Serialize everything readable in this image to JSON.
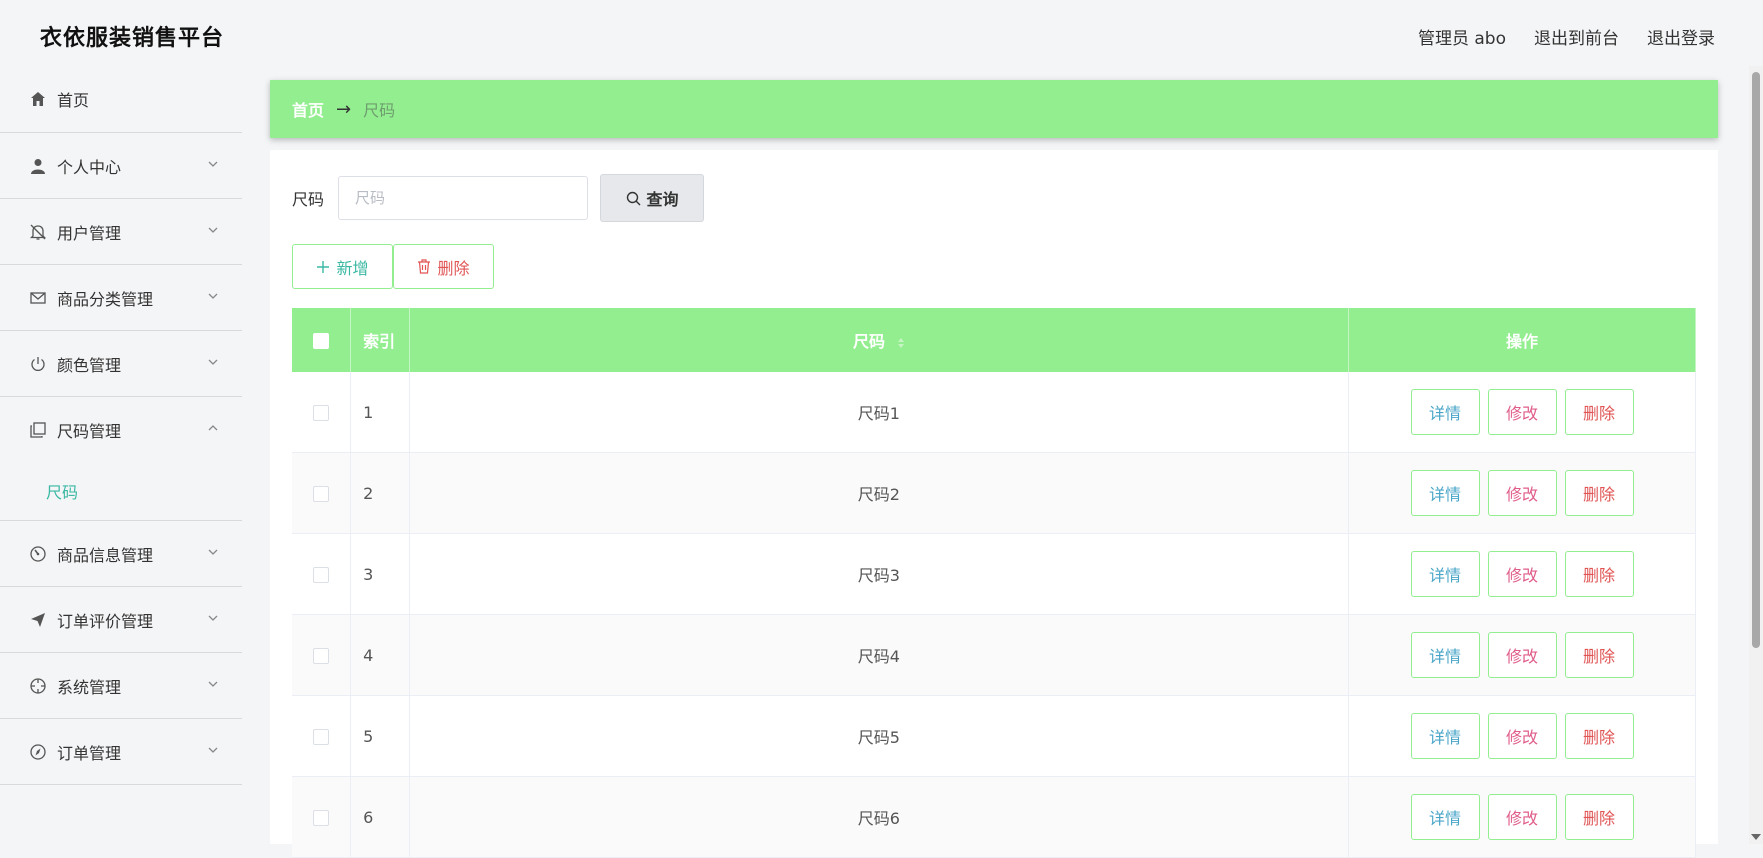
{
  "header": {
    "title": "衣依服装销售平台",
    "user": "管理员 abo",
    "to_front": "退出到前台",
    "logout": "退出登录"
  },
  "sidebar": {
    "items": [
      {
        "label": "首页",
        "icon": "home-icon"
      },
      {
        "label": "个人中心",
        "icon": "user-icon"
      },
      {
        "label": "用户管理",
        "icon": "bell-off-icon"
      },
      {
        "label": "商品分类管理",
        "icon": "mail-icon"
      },
      {
        "label": "颜色管理",
        "icon": "power-icon"
      },
      {
        "label": "尺码管理",
        "icon": "copy-icon"
      },
      {
        "label": "商品信息管理",
        "icon": "gauge-icon"
      },
      {
        "label": "订单评价管理",
        "icon": "send-icon"
      },
      {
        "label": "系统管理",
        "icon": "crosshair-icon"
      },
      {
        "label": "订单管理",
        "icon": "compass-icon"
      }
    ],
    "submenu": {
      "label": "尺码"
    }
  },
  "breadcrumb": {
    "home": "首页",
    "arrow": "→",
    "current": "尺码"
  },
  "search": {
    "label": "尺码",
    "placeholder": "尺码",
    "button": "查询"
  },
  "actions": {
    "add": "新增",
    "delete": "删除"
  },
  "table": {
    "headers": {
      "index": "索引",
      "size": "尺码",
      "ops": "操作"
    },
    "rows": [
      {
        "index": "1",
        "size": "尺码1"
      },
      {
        "index": "2",
        "size": "尺码2"
      },
      {
        "index": "3",
        "size": "尺码3"
      },
      {
        "index": "4",
        "size": "尺码4"
      },
      {
        "index": "5",
        "size": "尺码5"
      },
      {
        "index": "6",
        "size": "尺码6"
      }
    ],
    "op_labels": {
      "detail": "详情",
      "edit": "修改",
      "delete": "删除"
    }
  },
  "colors": {
    "accent": "#93ee90",
    "teal": "#3ab8a3",
    "danger": "#e05454"
  }
}
